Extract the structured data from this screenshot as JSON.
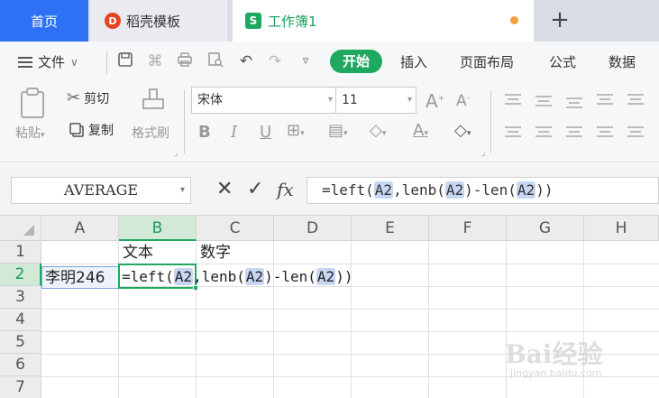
{
  "tabs": {
    "home": "首页",
    "template_icon": "D",
    "template": "稻壳模板",
    "book_icon": "S",
    "book": "工作簿1",
    "new_tab": "+"
  },
  "menu": {
    "file": "文件",
    "start": "开始",
    "insert": "插入",
    "layout": "页面布局",
    "formula": "公式",
    "data": "数据"
  },
  "ribbon": {
    "cut": "剪切",
    "paste": "粘贴",
    "copy": "复制",
    "format_painter": "格式刷",
    "font_name": "宋体",
    "font_size": "11",
    "bold": "B",
    "italic": "I",
    "underline": "U",
    "font_color": "A"
  },
  "formula_bar": {
    "name_box": "AVERAGE",
    "cancel": "✕",
    "confirm": "✓",
    "fx": "fx",
    "formula_parts": [
      "=left(",
      "A2",
      ",lenb(",
      "A2",
      ")-len(",
      "A2",
      "))"
    ]
  },
  "grid": {
    "columns": [
      "A",
      "B",
      "C",
      "D",
      "E",
      "F",
      "G",
      "H"
    ],
    "rows": [
      "1",
      "2",
      "3",
      "4",
      "5",
      "6",
      "7"
    ],
    "cells": {
      "B1": "文本",
      "C1": "数字",
      "A2": "李明246"
    },
    "formula_cell_parts": [
      "=left(",
      "A2",
      ",lenb(",
      "A2",
      ")-len(",
      "A2",
      "))"
    ]
  },
  "watermark": {
    "main": "Bai经验",
    "sub": "jingyan.baidu.com"
  },
  "colors": {
    "accent_green": "#1fa85f",
    "home_tab_blue": "#2d72f5",
    "reference_highlight": "#c7d6f2"
  }
}
